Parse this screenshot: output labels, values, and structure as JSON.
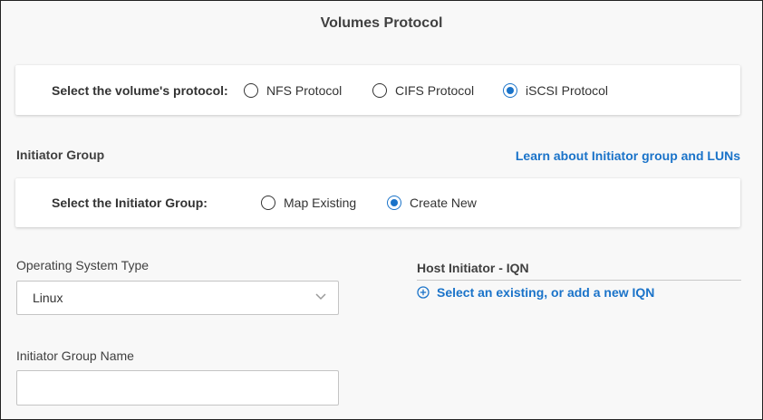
{
  "page": {
    "title": "Volumes Protocol"
  },
  "protocol": {
    "label": "Select the volume's protocol:",
    "options": [
      {
        "label": "NFS Protocol",
        "selected": false
      },
      {
        "label": "CIFS Protocol",
        "selected": false
      },
      {
        "label": "iSCSI Protocol",
        "selected": true
      }
    ]
  },
  "initiator_group": {
    "section_title": "Initiator Group",
    "learn_link": "Learn about Initiator group and LUNs",
    "label": "Select the Initiator Group:",
    "options": [
      {
        "label": "Map Existing",
        "selected": false
      },
      {
        "label": "Create New",
        "selected": true
      }
    ]
  },
  "os_type": {
    "label": "Operating System Type",
    "value": "Linux"
  },
  "group_name": {
    "label": "Initiator Group Name",
    "value": ""
  },
  "host_initiator": {
    "title": "Host Initiator - IQN",
    "add_link": "Select an existing, or add a new IQN"
  },
  "colors": {
    "accent": "#1a73c9",
    "background": "#f8f8f8",
    "card": "#ffffff",
    "text": "#333333"
  }
}
